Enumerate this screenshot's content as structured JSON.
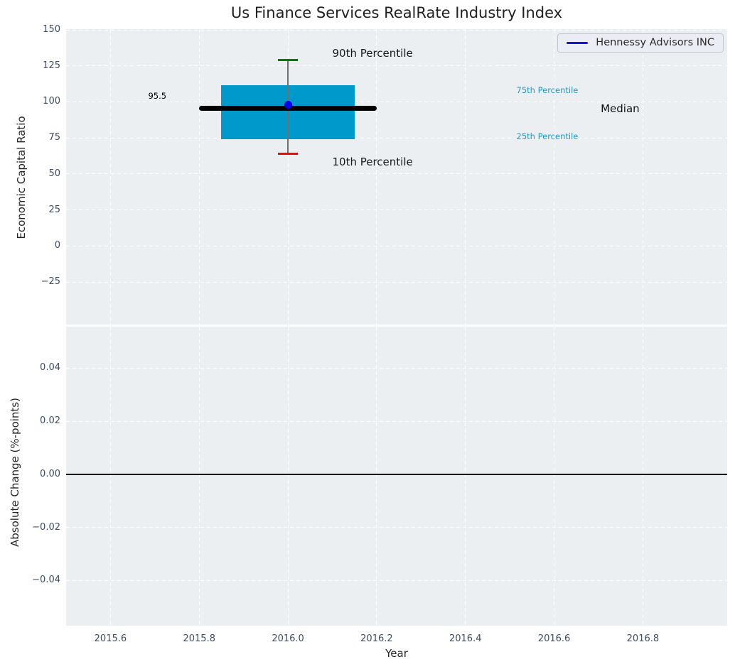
{
  "title": "Us Finance Services RealRate Industry Index",
  "legend": {
    "label": "Hennessy Advisors INC",
    "line_color": "#1414e0"
  },
  "colors": {
    "figure_bg": "#ffffff",
    "plot_bg": "#eceff1",
    "grid": "#ffffff",
    "box_fill": "#0099cc",
    "whisker": "#707070",
    "cap_upper": "#008000",
    "cap_lower": "#ff0000",
    "median_line": "#000000",
    "company_dot": "#0000ee",
    "zero_line": "#000000",
    "tick_label": "#3e4d63",
    "annotation_accent": "#1b9ace",
    "annotation_dark": "#1a1a1a"
  },
  "x_axis": {
    "label": "Year",
    "lim": [
      2015.5,
      2016.99
    ],
    "ticks": [
      {
        "v": 2015.6,
        "label": "2015.6"
      },
      {
        "v": 2015.8,
        "label": "2015.8"
      },
      {
        "v": 2016.0,
        "label": "2016.0"
      },
      {
        "v": 2016.2,
        "label": "2016.2"
      },
      {
        "v": 2016.4,
        "label": "2016.4"
      },
      {
        "v": 2016.6,
        "label": "2016.6"
      },
      {
        "v": 2016.8,
        "label": "2016.8"
      }
    ]
  },
  "chart_data": [
    {
      "type": "boxplot",
      "title": "Us Finance Services RealRate Industry Index",
      "ylabel": "Economic Capital Ratio",
      "ylim": [
        -54.5,
        150.5
      ],
      "grid": true,
      "legend_position": "upper right",
      "yticks": [
        {
          "v": 150,
          "label": "150"
        },
        {
          "v": 125,
          "label": "125"
        },
        {
          "v": 100,
          "label": "100"
        },
        {
          "v": 75,
          "label": "75"
        },
        {
          "v": 50,
          "label": "50"
        },
        {
          "v": 25,
          "label": "25"
        },
        {
          "v": 0,
          "label": "0"
        },
        {
          "v": -25,
          "label": "−25"
        }
      ],
      "box": {
        "x_center": 2016.0,
        "box_x": [
          2015.85,
          2016.15
        ],
        "median_x": [
          2015.8,
          2016.2
        ],
        "p10": 64,
        "p25": 74,
        "median": 95.5,
        "p75": 111.5,
        "p90": 129,
        "company_name": "Hennessy Advisors INC",
        "company_value": 98
      },
      "annotations": [
        {
          "id": "p90-label",
          "text": "90th Percentile",
          "x": 2016.1,
          "y": 133.5,
          "size": 15,
          "color": "#1a1a1a"
        },
        {
          "id": "p10-label",
          "text": "10th Percentile",
          "x": 2016.1,
          "y": 58.5,
          "size": 15,
          "color": "#1a1a1a"
        },
        {
          "id": "median-value",
          "text": "95.5",
          "x": 2015.685,
          "y": 104.3,
          "size": 11.5,
          "color": "#000000"
        },
        {
          "id": "p75-label",
          "text": "75th Percentile",
          "x": 2016.515,
          "y": 108.0,
          "size": 11.5,
          "color": "#1b9ace"
        },
        {
          "id": "p25-label",
          "text": "25th Percentile",
          "x": 2016.515,
          "y": 76.3,
          "size": 11.5,
          "color": "#1b9ace"
        },
        {
          "id": "median-label",
          "text": "Median",
          "x": 2016.705,
          "y": 95.3,
          "size": 15,
          "color": "#111111"
        }
      ]
    },
    {
      "type": "line",
      "xlabel": "Year",
      "ylabel": "Absolute Change (%-points)",
      "ylim": [
        -0.057,
        0.0556
      ],
      "grid": true,
      "yticks": [
        {
          "v": 0.04,
          "label": "0.04"
        },
        {
          "v": 0.02,
          "label": "0.02"
        },
        {
          "v": 0.0,
          "label": "0.00"
        },
        {
          "v": -0.02,
          "label": "−0.02"
        },
        {
          "v": -0.04,
          "label": "−0.04"
        }
      ],
      "zero_line": 0.0,
      "series": []
    }
  ]
}
